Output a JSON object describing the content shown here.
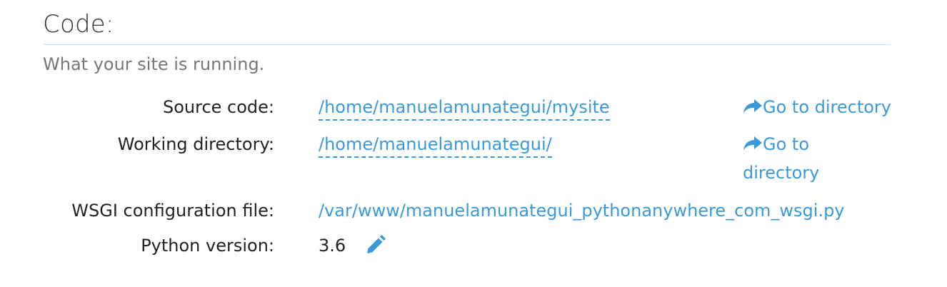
{
  "section": {
    "title": "Code:",
    "subtitle": "What your site is running."
  },
  "rows": {
    "source_code": {
      "label": "Source code:",
      "value": "/home/manuelamunategui/mysite",
      "action_label": "Go to directory",
      "action_icon": "share-arrow-icon"
    },
    "working_directory": {
      "label": "Working directory:",
      "value": "/home/manuelamunategui/",
      "action_label_line1": "Go to",
      "action_label_line2": "directory",
      "action_icon": "share-arrow-icon"
    },
    "wsgi_file": {
      "label": "WSGI configuration file:",
      "value": "/var/www/manuelamunategui_pythonanywhere_com_wsgi.py"
    },
    "python_version": {
      "label": "Python version:",
      "value": "3.6",
      "edit_icon": "pencil-icon"
    }
  },
  "colors": {
    "link": "#3a9ad9",
    "rule": "#c5e3f3",
    "text": "#222222",
    "muted": "#777777"
  }
}
